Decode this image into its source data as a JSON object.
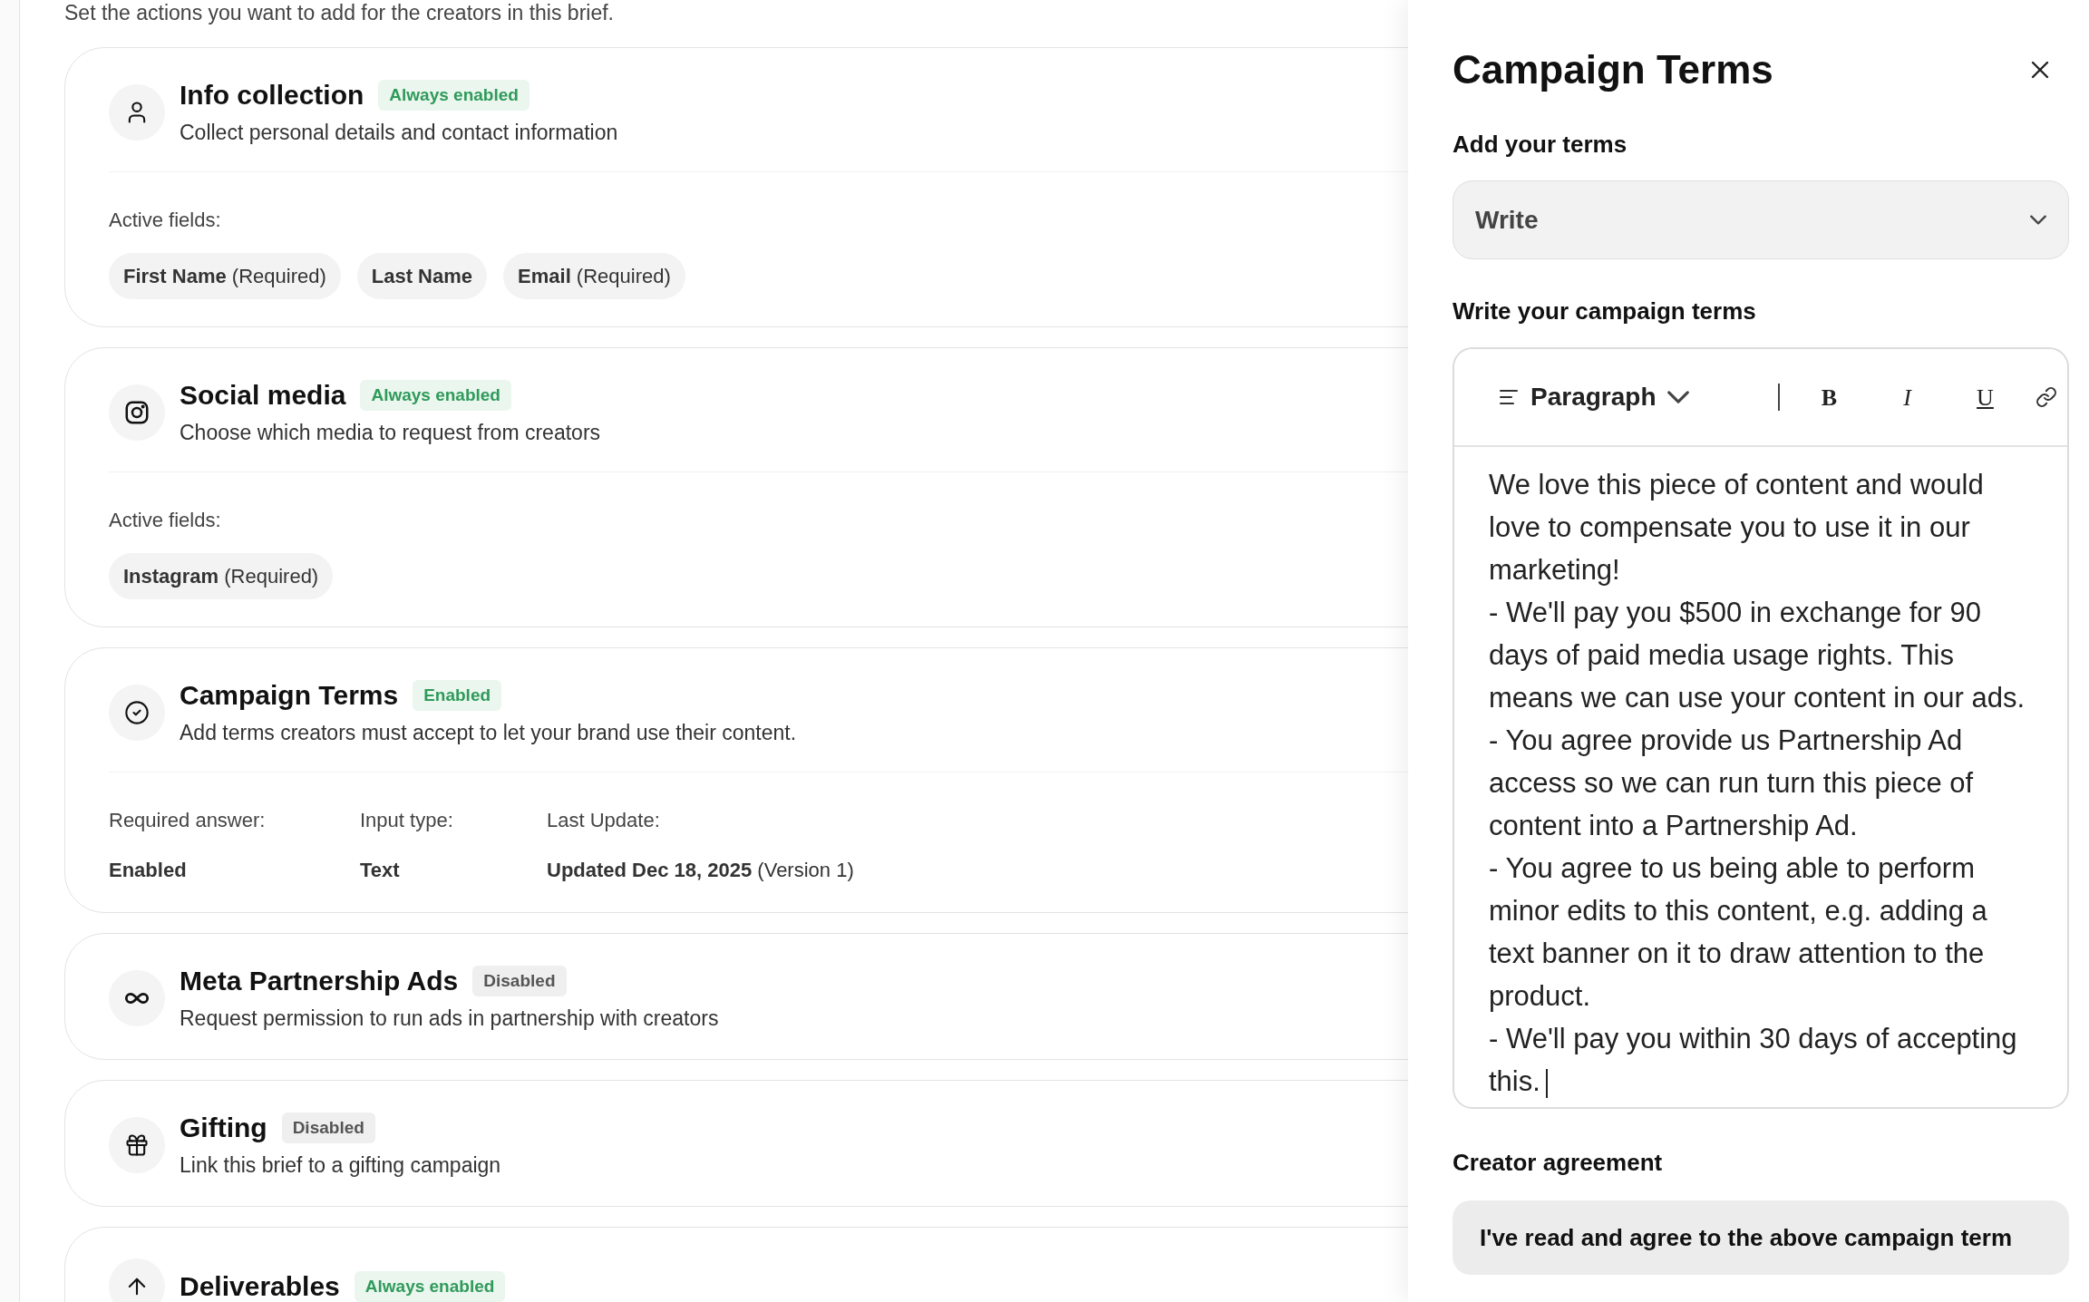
{
  "intro": "Set the actions you want to add for the creators in this brief.",
  "cards": [
    {
      "title": "Info collection",
      "enabled": true,
      "badge": "Always enabled",
      "description": "Collect personal details and contact information",
      "details": {
        "kind": "fields",
        "label": "Active fields:",
        "chips": [
          {
            "name": "First Name",
            "note": "(Required)"
          },
          {
            "name": "Last Name"
          },
          {
            "name": "Email",
            "note": "(Required)"
          }
        ]
      }
    },
    {
      "title": "Social media",
      "enabled": true,
      "badge": "Always enabled",
      "description": "Choose which media to request from creators",
      "details": {
        "kind": "fields",
        "label": "Active fields:",
        "chips": [
          {
            "name": "Instagram",
            "note": "(Required)"
          }
        ]
      }
    },
    {
      "title": "Campaign Terms",
      "enabled": true,
      "badge": "Enabled",
      "description": "Add terms creators must accept to let your brand use their content.",
      "details": {
        "kind": "info",
        "columns": [
          {
            "label": "Required answer:",
            "value": "Enabled"
          },
          {
            "label": "Input type:",
            "value": "Text"
          },
          {
            "label": "Last Update:",
            "value": "Updated Dec 18, 2025",
            "note": "(Version 1)"
          }
        ]
      }
    },
    {
      "title": "Meta Partnership Ads",
      "enabled": false,
      "badge": "Disabled",
      "description": "Request permission to run ads in partnership with creators"
    },
    {
      "title": "Gifting",
      "enabled": false,
      "badge": "Disabled",
      "description": "Link this brief to a gifting campaign"
    },
    {
      "title": "Deliverables",
      "enabled": true,
      "badge": "Always enabled"
    }
  ],
  "panel": {
    "title": "Campaign Terms",
    "add_label": "Add your terms",
    "select_value": "Write",
    "write_label": "Write your campaign terms",
    "toolbar": {
      "block_type": "Paragraph",
      "format_buttons": [
        "B",
        "I",
        "U"
      ]
    },
    "paragraphs": [
      "We love this piece of content and would love to compensate you to use it in our marketing!",
      "- We'll pay you $500 in exchange for 90 days of paid media usage rights. This means we can use your content in our ads.",
      "- You agree provide us Partnership Ad access so we can run turn this piece of content into a Partnership Ad.",
      "- You agree to us being able to perform minor edits to this content, e.g. adding a text banner on it to draw attention to the product.",
      "- We'll pay you within 30 days of accepting this."
    ],
    "agreement_label": "Creator agreement",
    "agreement_value": "I've read and agree to the above campaign term"
  }
}
